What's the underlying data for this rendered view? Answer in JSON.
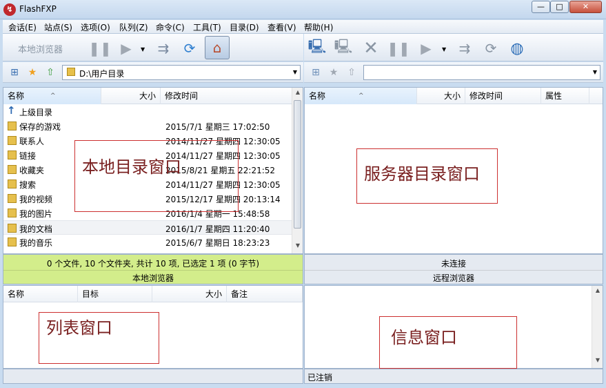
{
  "window": {
    "title": "FlashFXP",
    "icon_letter": "↯",
    "controls": {
      "minimize": "—",
      "maximize": "□",
      "close": "✕"
    }
  },
  "menu": [
    "会话(E)",
    "站点(S)",
    "选项(O)",
    "队列(Z)",
    "命令(C)",
    "工具(T)",
    "目录(D)",
    "查看(V)",
    "帮助(H)"
  ],
  "toolbar_left": {
    "label": "本地浏览器",
    "icons": [
      "pause-icon",
      "play-icon",
      "dropdown-arrow-icon",
      "transfer-icon",
      "refresh-icon",
      "home-icon"
    ]
  },
  "toolbar_right": {
    "icons": [
      "connect-icon",
      "disconnect-icon",
      "abort-icon",
      "pause-icon",
      "play-icon",
      "dropdown-arrow-icon",
      "transfer-icon",
      "refresh-icon",
      "globe-icon"
    ]
  },
  "local_path": {
    "value": "D:\\用户目录",
    "icons": [
      "tree-view-icon",
      "favorites-star-icon",
      "go-up-arrow-icon"
    ]
  },
  "remote_path": {
    "value": "",
    "icons": [
      "tree-view-icon",
      "favorites-star-icon",
      "go-up-arrow-icon"
    ]
  },
  "local_columns": {
    "name": "名称",
    "size": "大小",
    "modified": "修改时间"
  },
  "local_files": [
    {
      "name": "上级目录",
      "date": "",
      "icon": "up-arrow-icon"
    },
    {
      "name": "保存的游戏",
      "date": "2015/7/1 星期三 17:02:50",
      "icon": "folder-icon"
    },
    {
      "name": "联系人",
      "date": "2014/11/27 星期四 12:30:05",
      "icon": "folder-icon"
    },
    {
      "name": "链接",
      "date": "2014/11/27 星期四 12:30:05",
      "icon": "folder-icon"
    },
    {
      "name": "收藏夹",
      "date": "2015/8/21 星期五 22:21:52",
      "icon": "folder-icon"
    },
    {
      "name": "搜索",
      "date": "2014/11/27 星期四 12:30:05",
      "icon": "folder-icon"
    },
    {
      "name": "我的视频",
      "date": "2015/12/17 星期四 20:13:14",
      "icon": "folder-icon"
    },
    {
      "name": "我的图片",
      "date": "2016/1/4 星期一 15:48:58",
      "icon": "folder-icon"
    },
    {
      "name": "我的文档",
      "date": "2016/1/7 星期四 11:20:40",
      "icon": "folder-icon",
      "selected": true
    },
    {
      "name": "我的音乐",
      "date": "2015/6/7 星期日 18:23:23",
      "icon": "folder-icon"
    }
  ],
  "remote_columns": {
    "name": "名称",
    "size": "大小",
    "modified": "修改时间",
    "attributes": "属性"
  },
  "local_status": {
    "summary": "0 个文件, 10 个文件夹, 共计 10 项, 已选定 1 项 (0 字节)",
    "label": "本地浏览器"
  },
  "remote_status": {
    "summary": "未连接",
    "label": "远程浏览器"
  },
  "queue_columns": {
    "name": "名称",
    "target": "目标",
    "size": "大小",
    "note": "备注"
  },
  "bottom_status": "已注销",
  "annotations": {
    "local": "本地目录窗口",
    "remote": "服务器目录窗口",
    "queue": "列表窗口",
    "info": "信息窗口"
  },
  "colors": {
    "local_status_bg": "#d3ed8b",
    "annotation_border": "#cc2f2f",
    "annotation_text": "#7a2020"
  }
}
